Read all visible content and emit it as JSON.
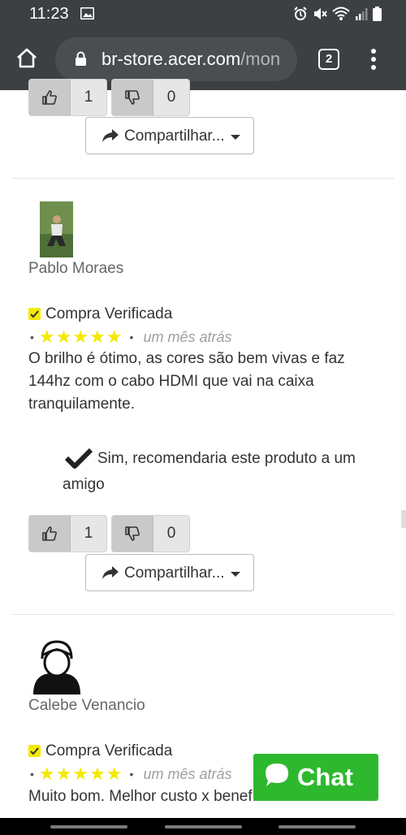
{
  "status_bar": {
    "time": "11:23"
  },
  "browser": {
    "url_host": "br-store.acer.com",
    "url_path": "/mon",
    "tab_count": "2"
  },
  "top_votes": {
    "up": "1",
    "down": "0",
    "share_label": "Compartilhar..."
  },
  "reviews": [
    {
      "author": "Pablo Moraes",
      "verified_label": "Compra Verificada",
      "stars": "★★★★★",
      "time": "um mês atrás",
      "text": "O brilho é ótimo, as cores são bem vivas e faz 144hz com o cabo HDMI que vai na caixa tranquilamente.",
      "recommend": "Sim, recomendaria este produto a um amigo",
      "up": "1",
      "down": "0",
      "share_label": "Compartilhar..."
    },
    {
      "author": "Calebe Venancio",
      "verified_label": "Compra Verificada",
      "stars": "★★★★★",
      "time": "um mês atrás",
      "text": "Muito bom. Melhor custo x benefício"
    }
  ],
  "chat": {
    "label": "Chat"
  },
  "colors": {
    "chrome_bg": "#3c4043",
    "star": "#f4e900",
    "chat": "#2eb82e"
  }
}
